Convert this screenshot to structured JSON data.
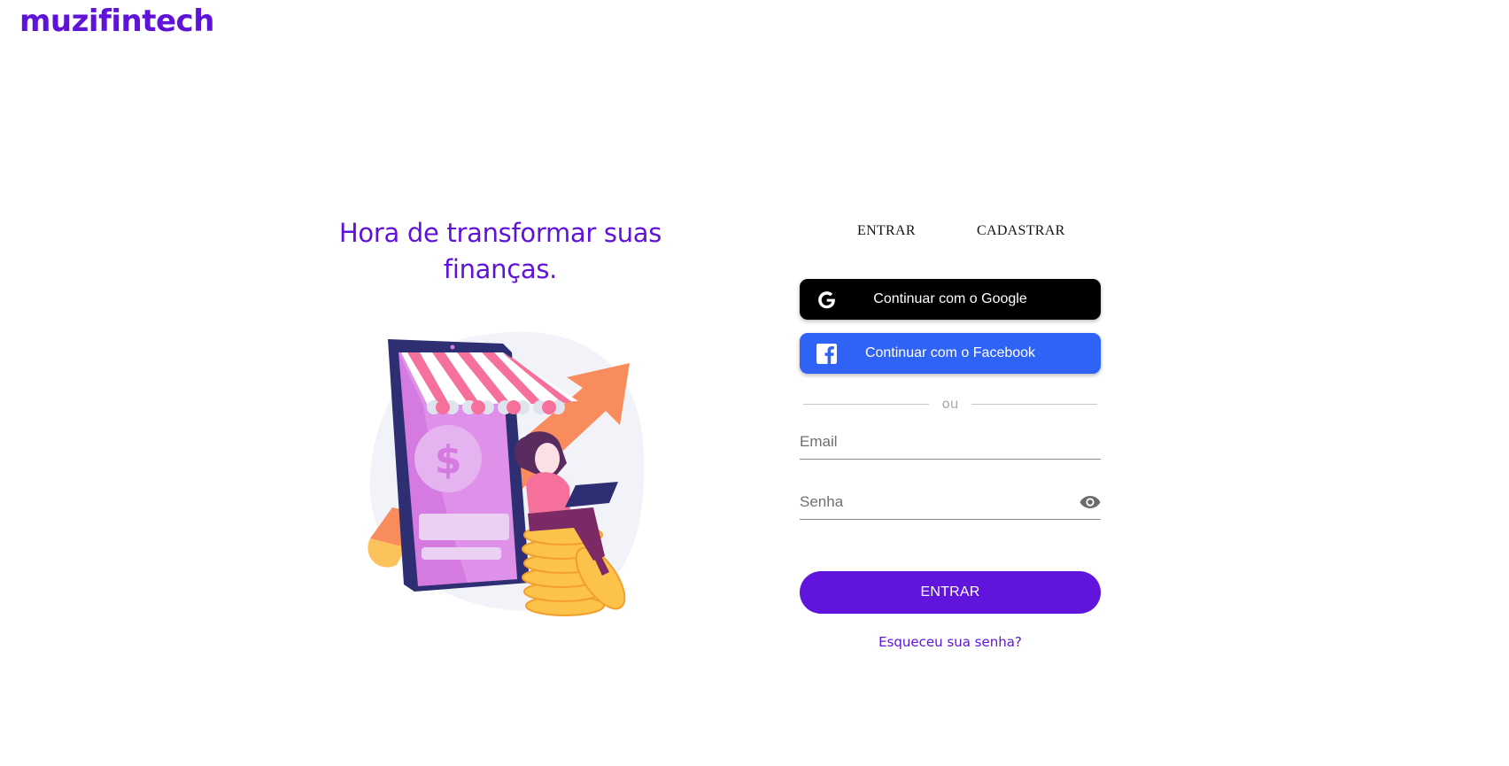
{
  "brand": {
    "logo_text": "muzifintech",
    "color": "#5f12d8"
  },
  "hero": {
    "headline_line1": "Hora de transformar suas",
    "headline_line2": "finanças.",
    "illustration": "online-store-finance-illustration"
  },
  "auth_tabs": {
    "login_label": "ENTRAR",
    "signup_label": "CADASTRAR"
  },
  "social": {
    "google_label": "Continuar com o Google",
    "google_icon": "google-icon",
    "facebook_label": "Continuar com o Facebook",
    "facebook_icon": "facebook-icon",
    "facebook_color": "#2f63f5"
  },
  "divider_text": "ou",
  "form": {
    "email_placeholder": "Email",
    "email_value": "",
    "password_placeholder": "Senha",
    "password_value": "",
    "password_toggle_icon": "eye-icon",
    "submit_label": "ENTRAR",
    "submit_color": "#6114dc",
    "forgot_label": "Esqueceu sua senha?"
  }
}
